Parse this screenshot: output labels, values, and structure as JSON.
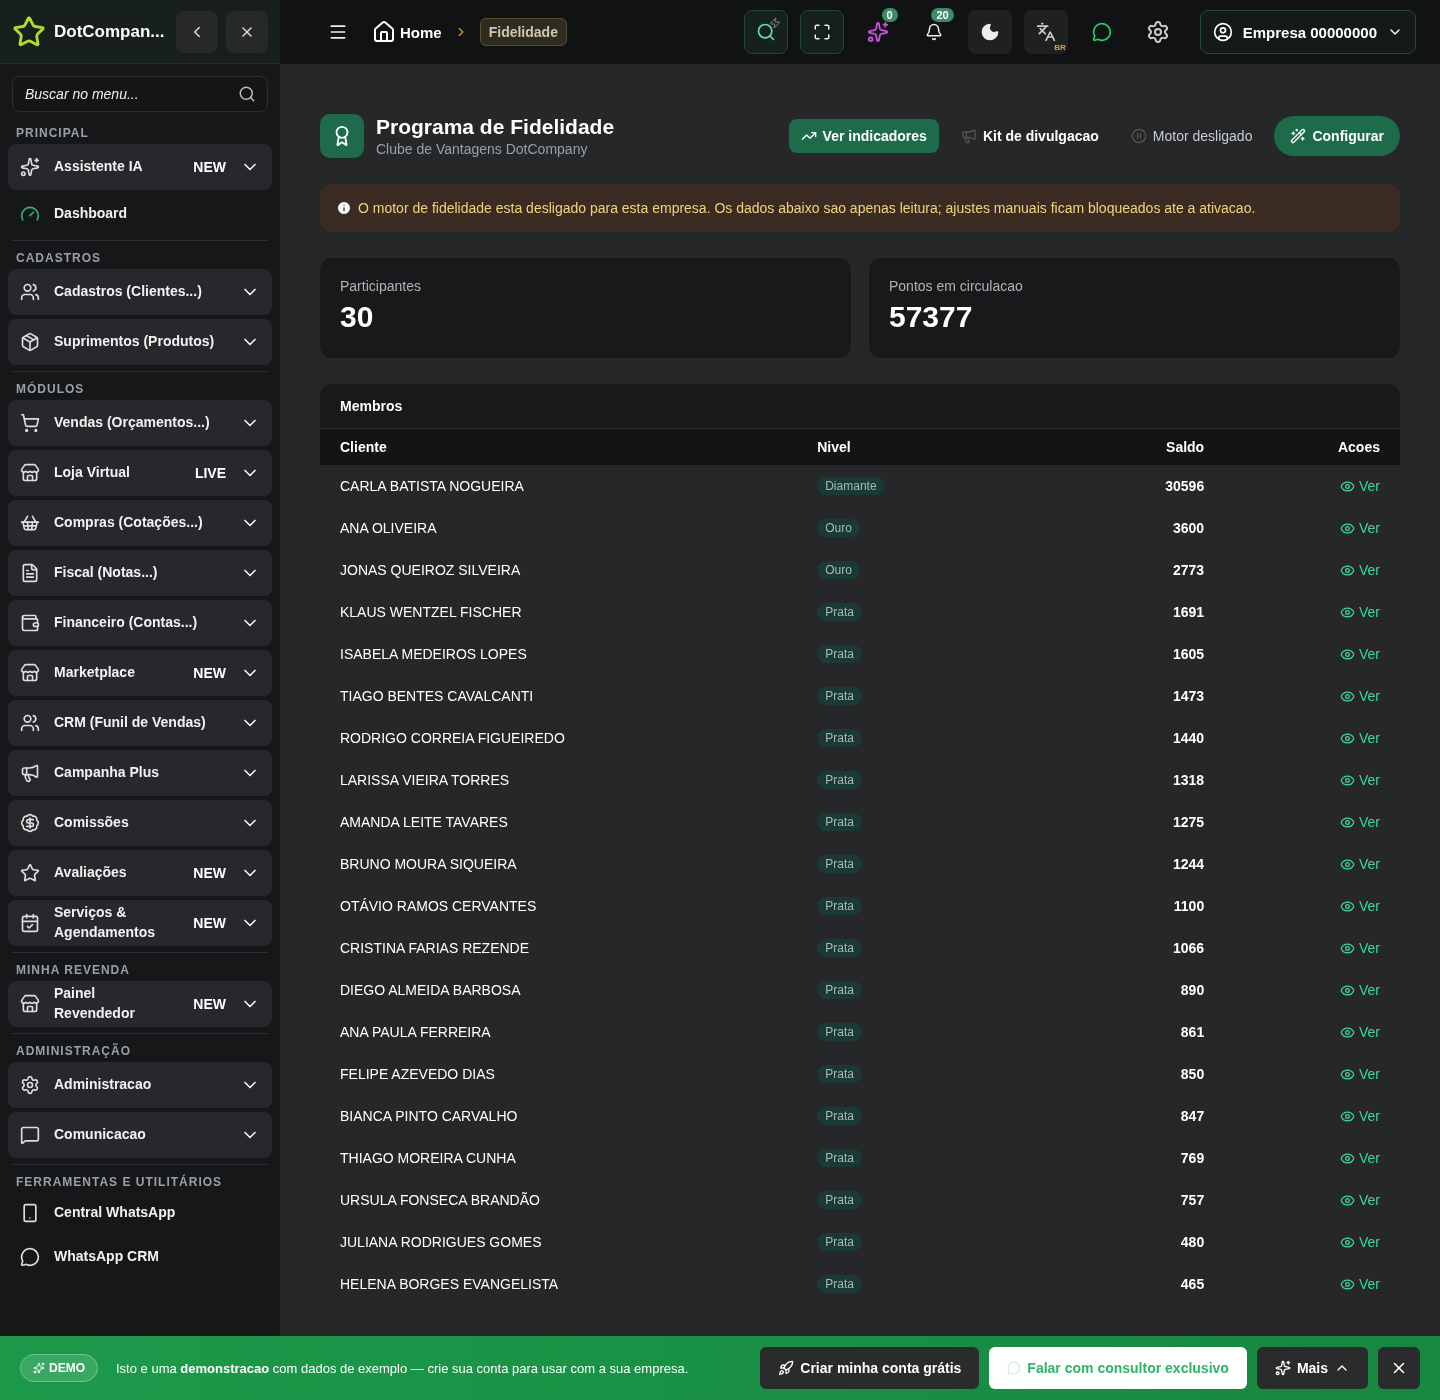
{
  "brand": {
    "name": "DotCompan..."
  },
  "sidebar": {
    "search_placeholder": "Buscar no menu...",
    "sections": [
      {
        "title": "PRINCIPAL",
        "items": [
          {
            "label": "Assistente IA",
            "kind": "group",
            "badge": "NEW"
          },
          {
            "label": "Dashboard",
            "kind": "link"
          }
        ]
      },
      {
        "title": "CADASTROS",
        "items": [
          {
            "label": "Cadastros (Clientes...)",
            "kind": "group"
          },
          {
            "label": "Suprimentos (Produtos)",
            "kind": "group"
          }
        ]
      },
      {
        "title": "MÓDULOS",
        "items": [
          {
            "label": "Vendas (Orçamentos...)",
            "kind": "group"
          },
          {
            "label": "Loja Virtual",
            "kind": "group",
            "badge": "LIVE"
          },
          {
            "label": "Compras (Cotações...)",
            "kind": "group"
          },
          {
            "label": "Fiscal (Notas...)",
            "kind": "group"
          },
          {
            "label": "Financeiro (Contas...)",
            "kind": "group"
          },
          {
            "label": "Marketplace",
            "kind": "group",
            "badge": "NEW"
          },
          {
            "label": "CRM (Funil de Vendas)",
            "kind": "group"
          },
          {
            "label": "Campanha Plus",
            "kind": "group"
          },
          {
            "label": "Comissões",
            "kind": "group"
          },
          {
            "label": "Avaliações",
            "kind": "group",
            "badge": "NEW"
          },
          {
            "label": "Serviços & Agendamentos",
            "kind": "group",
            "badge": "NEW"
          }
        ]
      },
      {
        "title": "MINHA REVENDA",
        "items": [
          {
            "label": "Painel Revendedor",
            "kind": "group",
            "badge": "NEW"
          }
        ]
      },
      {
        "title": "ADMINISTRAÇÃO",
        "items": [
          {
            "label": "Administracao",
            "kind": "group"
          },
          {
            "label": "Comunicacao",
            "kind": "group"
          }
        ]
      },
      {
        "title": "FERRAMENTAS E UTILITÁRIOS",
        "items": [
          {
            "label": "Central WhatsApp",
            "kind": "link"
          },
          {
            "label": "WhatsApp CRM",
            "kind": "link"
          }
        ]
      }
    ]
  },
  "topbar": {
    "breadcrumb": {
      "home": "Home",
      "current": "Fidelidade"
    },
    "ai_badge": "0",
    "notifications_badge": "20",
    "language": "BR",
    "account": "Empresa 00000000"
  },
  "page": {
    "title": "Programa de Fidelidade",
    "subtitle": "Clube de Vantagens DotCompany",
    "actions": [
      {
        "label": "Ver indicadores",
        "kind": "primary"
      },
      {
        "label": "Kit de divulgacao",
        "kind": "plain"
      },
      {
        "label": "Motor desligado",
        "kind": "status"
      },
      {
        "label": "Configurar",
        "kind": "accent"
      }
    ],
    "alert": "O motor de fidelidade esta desligado para esta empresa. Os dados abaixo sao apenas leitura; ajustes manuais ficam bloqueados ate a ativacao.",
    "stats": [
      {
        "label": "Participantes",
        "value": "30"
      },
      {
        "label": "Pontos em circulacao",
        "value": "57377"
      }
    ]
  },
  "members": {
    "title": "Membros",
    "columns": [
      "Cliente",
      "Nivel",
      "Saldo",
      "Acoes"
    ],
    "rows": [
      {
        "client": "CARLA BATISTA NOGUEIRA",
        "level": "Diamante",
        "balance": "30596",
        "action": "Ver"
      },
      {
        "client": "ANA OLIVEIRA",
        "level": "Ouro",
        "balance": "3600",
        "action": "Ver"
      },
      {
        "client": "JONAS QUEIROZ SILVEIRA",
        "level": "Ouro",
        "balance": "2773",
        "action": "Ver"
      },
      {
        "client": "KLAUS WENTZEL FISCHER",
        "level": "Prata",
        "balance": "1691",
        "action": "Ver"
      },
      {
        "client": "ISABELA MEDEIROS LOPES",
        "level": "Prata",
        "balance": "1605",
        "action": "Ver"
      },
      {
        "client": "TIAGO BENTES CAVALCANTI",
        "level": "Prata",
        "balance": "1473",
        "action": "Ver"
      },
      {
        "client": "RODRIGO CORREIA FIGUEIREDO",
        "level": "Prata",
        "balance": "1440",
        "action": "Ver"
      },
      {
        "client": "LARISSA VIEIRA TORRES",
        "level": "Prata",
        "balance": "1318",
        "action": "Ver"
      },
      {
        "client": "AMANDA LEITE TAVARES",
        "level": "Prata",
        "balance": "1275",
        "action": "Ver"
      },
      {
        "client": "BRUNO MOURA SIQUEIRA",
        "level": "Prata",
        "balance": "1244",
        "action": "Ver"
      },
      {
        "client": "OTÁVIO RAMOS CERVANTES",
        "level": "Prata",
        "balance": "1100",
        "action": "Ver"
      },
      {
        "client": "CRISTINA FARIAS REZENDE",
        "level": "Prata",
        "balance": "1066",
        "action": "Ver"
      },
      {
        "client": "DIEGO ALMEIDA BARBOSA",
        "level": "Prata",
        "balance": "890",
        "action": "Ver"
      },
      {
        "client": "ANA PAULA FERREIRA",
        "level": "Prata",
        "balance": "861",
        "action": "Ver"
      },
      {
        "client": "FELIPE AZEVEDO DIAS",
        "level": "Prata",
        "balance": "850",
        "action": "Ver"
      },
      {
        "client": "BIANCA PINTO CARVALHO",
        "level": "Prata",
        "balance": "847",
        "action": "Ver"
      },
      {
        "client": "THIAGO MOREIRA CUNHA",
        "level": "Prata",
        "balance": "769",
        "action": "Ver"
      },
      {
        "client": "URSULA FONSECA BRANDÃO",
        "level": "Prata",
        "balance": "757",
        "action": "Ver"
      },
      {
        "client": "JULIANA RODRIGUES GOMES",
        "level": "Prata",
        "balance": "480",
        "action": "Ver"
      },
      {
        "client": "HELENA BORGES EVANGELISTA",
        "level": "Prata",
        "balance": "465",
        "action": "Ver"
      }
    ]
  },
  "demo_banner": {
    "badge": "DEMO",
    "message": "Isto e uma **demonstracao** com dados de exemplo — crie sua conta para usar com a sua empresa.",
    "create_button": "Criar minha conta grátis",
    "consult_button": "Falar com consultor exclusivo",
    "more_button": "Mais"
  }
}
